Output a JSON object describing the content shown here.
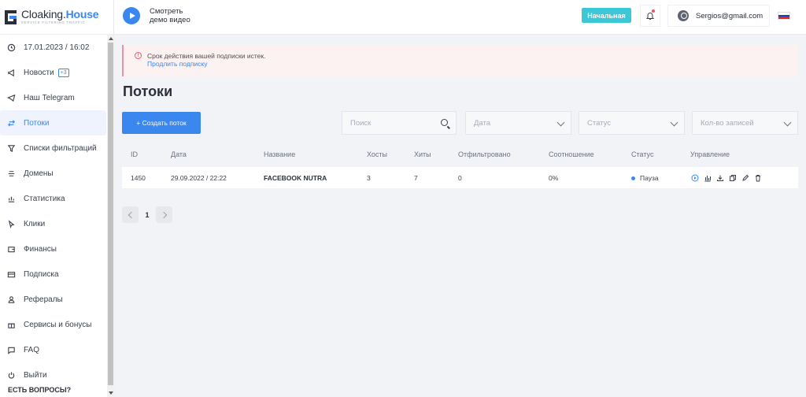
{
  "brand": {
    "name_part1": "Cloaking.",
    "name_part2": "House",
    "tagline": "SERVICE FILTERING TRAFFIC"
  },
  "sidebar": {
    "items": [
      {
        "label": "17.01.2023 / 16:02",
        "icon": "clock-icon"
      },
      {
        "label": "Новости",
        "icon": "megaphone-icon",
        "badge": "+3"
      },
      {
        "label": "Наш Telegram",
        "icon": "telegram-icon"
      },
      {
        "label": "Потоки",
        "icon": "streams-icon",
        "active": true
      },
      {
        "label": "Списки фильтраций",
        "icon": "filter-icon"
      },
      {
        "label": "Домены",
        "icon": "domains-icon"
      },
      {
        "label": "Статистика",
        "icon": "chart-icon"
      },
      {
        "label": "Клики",
        "icon": "cursor-icon"
      },
      {
        "label": "Финансы",
        "icon": "wallet-icon"
      },
      {
        "label": "Подписка",
        "icon": "card-icon"
      },
      {
        "label": "Рефералы",
        "icon": "user-icon"
      },
      {
        "label": "Сервисы и бонусы",
        "icon": "gift-icon"
      },
      {
        "label": "FAQ",
        "icon": "chat-icon"
      },
      {
        "label": "Выйти",
        "icon": "power-icon"
      }
    ],
    "questions_label": "ЕСТЬ ВОПРОСЫ?"
  },
  "header": {
    "demo_line1": "Смотреть",
    "demo_line2": "демо видео",
    "plan_label": "Начальная",
    "email": "Sergios@gmail.com"
  },
  "alert": {
    "message": "Срок действия вашей подписки истек.",
    "link": "Продлить подписку"
  },
  "page": {
    "title": "Потоки",
    "create_button": "+ Создать поток"
  },
  "filters": {
    "search_placeholder": "Поиск",
    "date_placeholder": "Дата",
    "status_placeholder": "Статус",
    "count_placeholder": "Кол-во записей"
  },
  "table": {
    "columns": [
      "ID",
      "Дата",
      "Название",
      "Хосты",
      "Хиты",
      "Отфильтровано",
      "Соотношение",
      "Статус",
      "Управление"
    ],
    "rows": [
      {
        "id": "1450",
        "date": "29.09.2022 / 22:22",
        "name": "FACEBOOK NUTRA",
        "hosts": "3",
        "hits": "7",
        "filtered": "0",
        "ratio": "0%",
        "status": "Пауза"
      }
    ]
  },
  "pagination": {
    "current": "1"
  },
  "colors": {
    "accent": "#3a87f0",
    "plan": "#3cc7d6",
    "alert_border": "#f08fa1"
  }
}
